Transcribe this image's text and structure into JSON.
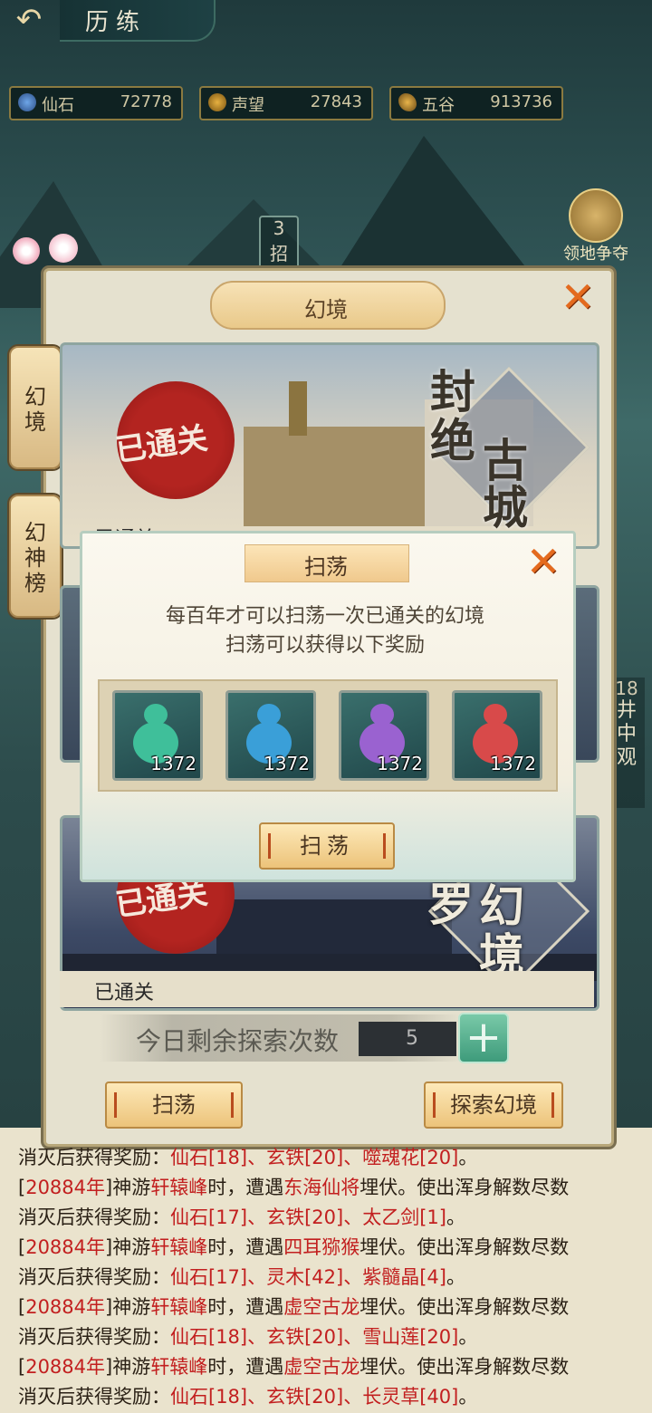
{
  "header": {
    "title": "历练"
  },
  "resources": [
    {
      "name": "仙石",
      "value": "72778",
      "icon": "spirit-stone-icon"
    },
    {
      "name": "声望",
      "value": "27843",
      "icon": "prestige-icon"
    },
    {
      "name": "五谷",
      "value": "913736",
      "icon": "grain-icon"
    }
  ],
  "map_features": {
    "territory": "领地争夺",
    "badge_top": "3",
    "badge_top_char": "招",
    "side_count": "18",
    "side_place": [
      "井",
      "中",
      "观"
    ]
  },
  "panel": {
    "title": "幻境",
    "tabs": [
      {
        "label": [
          "幻",
          "境"
        ]
      },
      {
        "label": [
          "幻",
          "神",
          "榜"
        ]
      }
    ],
    "realms": [
      {
        "name": [
          "封",
          "绝",
          "古",
          "城"
        ],
        "status": "已通关",
        "seal": "已通关"
      },
      {
        "name": [
          "罗",
          "幻",
          "境"
        ],
        "status": "已通关",
        "seal": "已通关"
      }
    ],
    "remaining_label": "今日剩余探索次数",
    "remaining_value": "5",
    "sweep_button": "扫荡",
    "explore_button": "探索幻境"
  },
  "dialog": {
    "title": "扫荡",
    "line1": "每百年才可以扫荡一次已通关的幻境",
    "line2": "扫荡可以获得以下奖励",
    "rewards": [
      {
        "count": "1372",
        "color": "#3fbf9a"
      },
      {
        "count": "1372",
        "color": "#3a9fd8"
      },
      {
        "count": "1372",
        "color": "#9a62d0"
      },
      {
        "count": "1372",
        "color": "#d84a4a"
      }
    ],
    "confirm_button": "扫荡"
  },
  "log": [
    {
      "tail": "消灭后获得奖励：",
      "items": "仙石[18]、玄铁[20]、噬魂花[20]",
      "end": "。"
    },
    {
      "year": "20884年",
      "a": "神游",
      "place": "轩辕峰",
      "b": "时，遭遇",
      "enemy": "东海仙将",
      "c": "埋伏。使出浑身解数尽数"
    },
    {
      "tail": "消灭后获得奖励：",
      "items": "仙石[17]、玄铁[20]、太乙剑[1]",
      "end": "。"
    },
    {
      "year": "20884年",
      "a": "神游",
      "place": "轩辕峰",
      "b": "时，遭遇",
      "enemy": "四耳猕猴",
      "c": "埋伏。使出浑身解数尽数"
    },
    {
      "tail": "消灭后获得奖励：",
      "items": "仙石[17]、灵木[42]、紫髓晶[4]",
      "end": "。"
    },
    {
      "year": "20884年",
      "a": "神游",
      "place": "轩辕峰",
      "b": "时，遭遇",
      "enemy": "虚空古龙",
      "c": "埋伏。使出浑身解数尽数"
    },
    {
      "tail": "消灭后获得奖励：",
      "items": "仙石[18]、玄铁[20]、雪山莲[20]",
      "end": "。"
    },
    {
      "year": "20884年",
      "a": "神游",
      "place": "轩辕峰",
      "b": "时，遭遇",
      "enemy": "虚空古龙",
      "c": "埋伏。使出浑身解数尽数"
    },
    {
      "tail": "消灭后获得奖励：",
      "items": "仙石[18]、玄铁[20]、长灵草[40]",
      "end": "。"
    }
  ]
}
